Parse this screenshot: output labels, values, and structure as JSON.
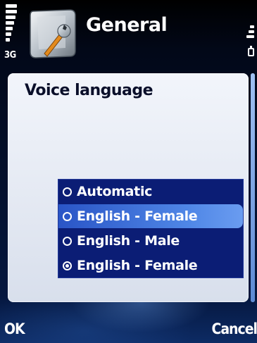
{
  "status": {
    "network_label": "3G",
    "signal_icon": "signal-strength-icon",
    "battery_icon": "battery-icon"
  },
  "header": {
    "title": "General",
    "icon": "settings-wrench-icon"
  },
  "panel": {
    "title": "Voice language"
  },
  "options": {
    "items": [
      {
        "label": "Automatic",
        "selected": false,
        "highlighted": false
      },
      {
        "label": "English - Female",
        "selected": false,
        "highlighted": true
      },
      {
        "label": "English - Male",
        "selected": false,
        "highlighted": false
      },
      {
        "label": "English - Female",
        "selected": true,
        "highlighted": false
      }
    ]
  },
  "softkeys": {
    "left": "OK",
    "right": "Cancel"
  },
  "colors": {
    "list_background": "#0b1d75",
    "highlight": "#4f86e6",
    "panel": "#eef2f9"
  }
}
